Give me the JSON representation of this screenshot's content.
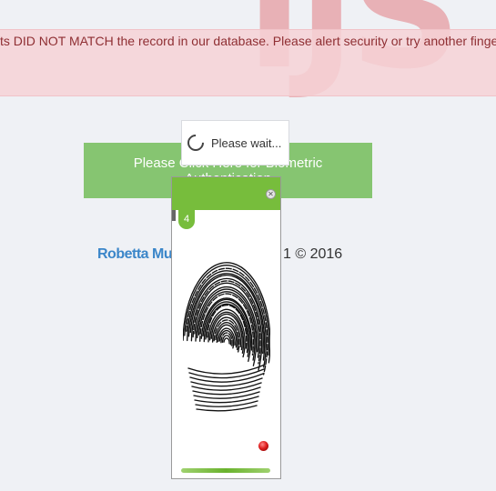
{
  "watermark": "IJS",
  "alert": {
    "text": "ts DID NOT MATCH the record in our database. Please alert security or try another finge",
    "color": "#8f2f33"
  },
  "auth_button": {
    "label": "Please Click Here for Biometric Authentication",
    "color": "#86c571"
  },
  "wait": {
    "label": "Please wait...",
    "icon": "spinner-icon"
  },
  "footer": {
    "name": "Robetta Mu",
    "copyright": "1 © 2016"
  },
  "scanner": {
    "step": "4",
    "close_icon": "close-icon",
    "accent": "#77bd3c",
    "status": "red-led",
    "progress": 1.0
  }
}
